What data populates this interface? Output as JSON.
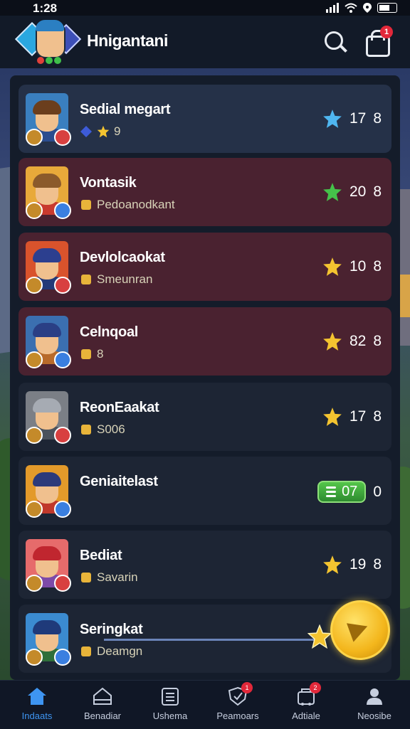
{
  "status_bar": {
    "time": "1:28"
  },
  "header": {
    "title": "Hnigantani",
    "cart_badge": "1"
  },
  "rows": [
    {
      "name": "Sedial megart",
      "sub": "9",
      "score": "17",
      "rank": "8",
      "style": "blue",
      "star_color": "#4fb6f0"
    },
    {
      "name": "Vontasik",
      "sub": "Pedoanodkant",
      "score": "20",
      "rank": "8",
      "style": "red",
      "star_color": "#45c24a"
    },
    {
      "name": "Devlolcaokat",
      "sub": "Smeunran",
      "score": "10",
      "rank": "8",
      "style": "red",
      "star_color": "#f4c430"
    },
    {
      "name": "Celnqoal",
      "sub": "8",
      "score": "82",
      "rank": "8",
      "style": "red",
      "star_color": "#f4c430"
    },
    {
      "name": "ReonEaakat",
      "sub": "S006",
      "score": "17",
      "rank": "8",
      "style": "dark",
      "star_color": "#f4c430"
    },
    {
      "name": "Geniaitelast",
      "sub": "",
      "score": "07",
      "rank": "0",
      "style": "dark",
      "star_color": "#45c24a"
    },
    {
      "name": "Bediat",
      "sub": "Savarin",
      "score": "19",
      "rank": "8",
      "style": "dark",
      "star_color": "#f4c430"
    },
    {
      "name": "Seringkat",
      "sub": "Deamgn",
      "score": "",
      "rank": "",
      "style": "dark",
      "star_color": "#f4c430"
    }
  ],
  "nav": {
    "tabs": [
      {
        "label": "Indaats",
        "icon": "home-icon"
      },
      {
        "label": "Benadiar",
        "icon": "house-outline-icon"
      },
      {
        "label": "Ushema",
        "icon": "list-icon"
      },
      {
        "label": "Peamoars",
        "icon": "shield-icon",
        "badge": "1"
      },
      {
        "label": "Adtiale",
        "icon": "store-icon",
        "badge": "2"
      },
      {
        "label": "Neosibe",
        "icon": "profile-icon"
      }
    ]
  }
}
